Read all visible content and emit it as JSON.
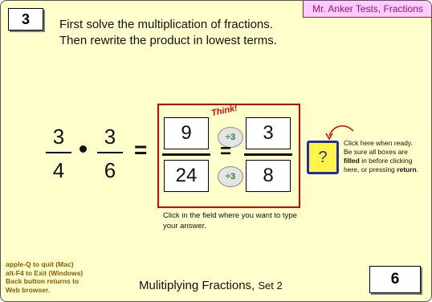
{
  "header": {
    "title_tag": "Mr. Anker Tests, Fractions",
    "problem_number": "3",
    "instructions": "First solve the multiplication of fractions.  Then rewrite the product in lowest terms."
  },
  "problem": {
    "frac1": {
      "num": "3",
      "den": "4"
    },
    "operator": "•",
    "frac2": {
      "num": "3",
      "den": "6"
    },
    "equals": "="
  },
  "answer": {
    "think_label": "Think!",
    "product_numerator": "9",
    "product_denominator": "24",
    "reduced_numerator": "3",
    "reduced_denominator": "8",
    "divide_hint_top": "÷3",
    "divide_hint_bottom": "÷3",
    "equals": "="
  },
  "submit": {
    "label": "?",
    "hint_line1": "Click here when ready.",
    "hint_line2": "Be sure all boxes are",
    "hint_line3_a": "filled",
    "hint_line3_b": " in before clicking",
    "hint_line4_a": "here, or pressing ",
    "hint_line4_b": "return",
    "hint_line4_c": "."
  },
  "field_hint": "Click in the field where you want to type your answer.",
  "quit_info": {
    "line1": "apple-Q to quit (Mac)",
    "line2": "alt-F4 to Exit (Windows)",
    "line3": "Back button returns to",
    "line4": "Web browser."
  },
  "footer": {
    "title": "Mulitiplying Fractions, ",
    "set": "Set 2",
    "score": "6"
  },
  "colors": {
    "background": "#ffffcc",
    "answer_frame": "#e00000",
    "submit_fill": "#fff44a",
    "submit_border": "#1f2fa5",
    "title_tag_bg": "#ffccff"
  }
}
